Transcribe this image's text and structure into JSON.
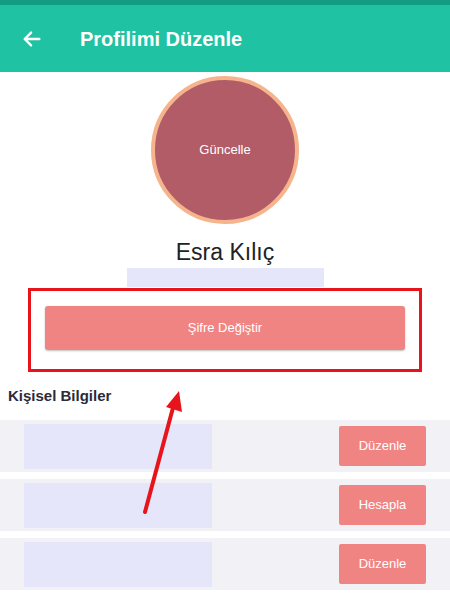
{
  "header": {
    "title": "Profilimi Düzenle"
  },
  "avatar": {
    "overlay": "Güncelle"
  },
  "profile": {
    "name": "Esra Kılıç"
  },
  "password_button": {
    "label": "Şifre Değiştir",
    "highlighted": true
  },
  "section": {
    "title": "Kişisel Bilgiler"
  },
  "rows": [
    {
      "button": "Düzenle"
    },
    {
      "button": "Hesapla"
    },
    {
      "button": "Düzenle"
    }
  ]
}
